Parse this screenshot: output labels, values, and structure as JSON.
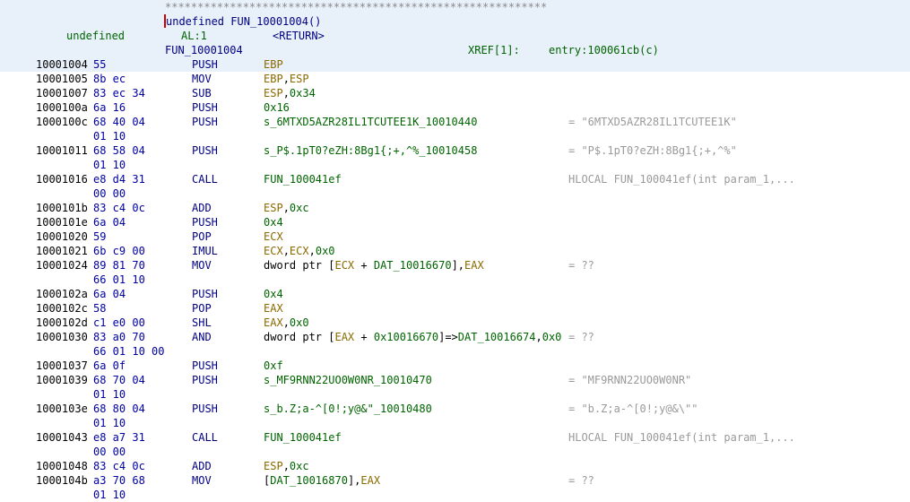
{
  "header": {
    "stars": "***********************************************************",
    "signature": "undefined FUN_10001004()",
    "ret_type": "undefined",
    "ret_storage": "AL:1",
    "ret_name": "<RETURN>",
    "func_label": "FUN_10001004",
    "xref_label": "XREF[1]:",
    "xref_value": "entry:100061cb(c)"
  },
  "rows": [
    {
      "addr": "10001004",
      "bytes": "55",
      "mnem": "PUSH",
      "ops": [
        {
          "t": "EBP",
          "c": "reg"
        }
      ],
      "cmt": ""
    },
    {
      "addr": "10001005",
      "bytes": "8b ec",
      "mnem": "MOV",
      "ops": [
        {
          "t": "EBP",
          "c": "reg"
        },
        {
          "t": ",",
          "c": "plain"
        },
        {
          "t": "ESP",
          "c": "reg"
        }
      ],
      "cmt": ""
    },
    {
      "addr": "10001007",
      "bytes": "83 ec 34",
      "mnem": "SUB",
      "ops": [
        {
          "t": "ESP",
          "c": "reg"
        },
        {
          "t": ",",
          "c": "plain"
        },
        {
          "t": "0x34",
          "c": "num"
        }
      ],
      "cmt": ""
    },
    {
      "addr": "1000100a",
      "bytes": "6a 16",
      "mnem": "PUSH",
      "ops": [
        {
          "t": "0x16",
          "c": "num"
        }
      ],
      "cmt": ""
    },
    {
      "addr": "1000100c",
      "bytes": "68 40 04",
      "mnem": "PUSH",
      "ops": [
        {
          "t": "s_6MTXD5AZR28IL1TCUTEE1K_10010440",
          "c": "label"
        }
      ],
      "cmt": "= \"6MTXD5AZR28IL1TCUTEE1K\""
    },
    {
      "addr": "",
      "bytes": "01 10",
      "mnem": "",
      "ops": [],
      "cmt": ""
    },
    {
      "addr": "10001011",
      "bytes": "68 58 04",
      "mnem": "PUSH",
      "ops": [
        {
          "t": "s_P$.1pT0?eZH:8Bg1{;+,^%_10010458",
          "c": "label"
        }
      ],
      "cmt": "= \"P$.1pT0?eZH:8Bg1{;+,^%\""
    },
    {
      "addr": "",
      "bytes": "01 10",
      "mnem": "",
      "ops": [],
      "cmt": ""
    },
    {
      "addr": "10001016",
      "bytes": "e8 d4 31",
      "mnem": "CALL",
      "ops": [
        {
          "t": "FUN_100041ef",
          "c": "label"
        }
      ],
      "cmt": "HLOCAL FUN_100041ef(int param_1,..."
    },
    {
      "addr": "",
      "bytes": "00 00",
      "mnem": "",
      "ops": [],
      "cmt": ""
    },
    {
      "addr": "1000101b",
      "bytes": "83 c4 0c",
      "mnem": "ADD",
      "ops": [
        {
          "t": "ESP",
          "c": "reg"
        },
        {
          "t": ",",
          "c": "plain"
        },
        {
          "t": "0xc",
          "c": "num"
        }
      ],
      "cmt": ""
    },
    {
      "addr": "1000101e",
      "bytes": "6a 04",
      "mnem": "PUSH",
      "ops": [
        {
          "t": "0x4",
          "c": "num"
        }
      ],
      "cmt": ""
    },
    {
      "addr": "10001020",
      "bytes": "59",
      "mnem": "POP",
      "ops": [
        {
          "t": "ECX",
          "c": "reg"
        }
      ],
      "cmt": ""
    },
    {
      "addr": "10001021",
      "bytes": "6b c9 00",
      "mnem": "IMUL",
      "ops": [
        {
          "t": "ECX",
          "c": "reg"
        },
        {
          "t": ",",
          "c": "plain"
        },
        {
          "t": "ECX",
          "c": "reg"
        },
        {
          "t": ",",
          "c": "plain"
        },
        {
          "t": "0x0",
          "c": "num"
        }
      ],
      "cmt": ""
    },
    {
      "addr": "10001024",
      "bytes": "89 81 70",
      "mnem": "MOV",
      "ops": [
        {
          "t": "dword ptr [",
          "c": "plain"
        },
        {
          "t": "ECX",
          "c": "reg"
        },
        {
          "t": " + ",
          "c": "plain"
        },
        {
          "t": "DAT_10016670",
          "c": "label"
        },
        {
          "t": "],",
          "c": "plain"
        },
        {
          "t": "EAX",
          "c": "reg"
        }
      ],
      "cmt": "= ??"
    },
    {
      "addr": "",
      "bytes": "66 01 10",
      "mnem": "",
      "ops": [],
      "cmt": ""
    },
    {
      "addr": "1000102a",
      "bytes": "6a 04",
      "mnem": "PUSH",
      "ops": [
        {
          "t": "0x4",
          "c": "num"
        }
      ],
      "cmt": ""
    },
    {
      "addr": "1000102c",
      "bytes": "58",
      "mnem": "POP",
      "ops": [
        {
          "t": "EAX",
          "c": "reg"
        }
      ],
      "cmt": ""
    },
    {
      "addr": "1000102d",
      "bytes": "c1 e0 00",
      "mnem": "SHL",
      "ops": [
        {
          "t": "EAX",
          "c": "reg"
        },
        {
          "t": ",",
          "c": "plain"
        },
        {
          "t": "0x0",
          "c": "num"
        }
      ],
      "cmt": ""
    },
    {
      "addr": "10001030",
      "bytes": "83 a0 70",
      "mnem": "AND",
      "ops": [
        {
          "t": "dword ptr [",
          "c": "plain"
        },
        {
          "t": "EAX",
          "c": "reg"
        },
        {
          "t": " + ",
          "c": "plain"
        },
        {
          "t": "0x10016670",
          "c": "num"
        },
        {
          "t": "]=>",
          "c": "plain"
        },
        {
          "t": "DAT_10016674",
          "c": "label"
        },
        {
          "t": ",",
          "c": "plain"
        },
        {
          "t": "0x0",
          "c": "num"
        }
      ],
      "cmt": "= ??"
    },
    {
      "addr": "",
      "bytes": "66 01 10 00",
      "mnem": "",
      "ops": [],
      "cmt": ""
    },
    {
      "addr": "10001037",
      "bytes": "6a 0f",
      "mnem": "PUSH",
      "ops": [
        {
          "t": "0xf",
          "c": "num"
        }
      ],
      "cmt": ""
    },
    {
      "addr": "10001039",
      "bytes": "68 70 04",
      "mnem": "PUSH",
      "ops": [
        {
          "t": "s_MF9RNN22UO0W0NR_10010470",
          "c": "label"
        }
      ],
      "cmt": "= \"MF9RNN22UO0W0NR\""
    },
    {
      "addr": "",
      "bytes": "01 10",
      "mnem": "",
      "ops": [],
      "cmt": ""
    },
    {
      "addr": "1000103e",
      "bytes": "68 80 04",
      "mnem": "PUSH",
      "ops": [
        {
          "t": "s_b.Z;a-^[0!;y@&\"_10010480",
          "c": "label"
        }
      ],
      "cmt": "= \"b.Z;a-^[0!;y@&\\\"\""
    },
    {
      "addr": "",
      "bytes": "01 10",
      "mnem": "",
      "ops": [],
      "cmt": ""
    },
    {
      "addr": "10001043",
      "bytes": "e8 a7 31",
      "mnem": "CALL",
      "ops": [
        {
          "t": "FUN_100041ef",
          "c": "label"
        }
      ],
      "cmt": "HLOCAL FUN_100041ef(int param_1,..."
    },
    {
      "addr": "",
      "bytes": "00 00",
      "mnem": "",
      "ops": [],
      "cmt": ""
    },
    {
      "addr": "10001048",
      "bytes": "83 c4 0c",
      "mnem": "ADD",
      "ops": [
        {
          "t": "ESP",
          "c": "reg"
        },
        {
          "t": ",",
          "c": "plain"
        },
        {
          "t": "0xc",
          "c": "num"
        }
      ],
      "cmt": ""
    },
    {
      "addr": "1000104b",
      "bytes": "a3 70 68",
      "mnem": "MOV",
      "ops": [
        {
          "t": "[",
          "c": "plain"
        },
        {
          "t": "DAT_10016870",
          "c": "label"
        },
        {
          "t": "],",
          "c": "plain"
        },
        {
          "t": "EAX",
          "c": "reg"
        }
      ],
      "cmt": "= ??"
    },
    {
      "addr": "",
      "bytes": "01 10",
      "mnem": "",
      "ops": [],
      "cmt": ""
    }
  ]
}
